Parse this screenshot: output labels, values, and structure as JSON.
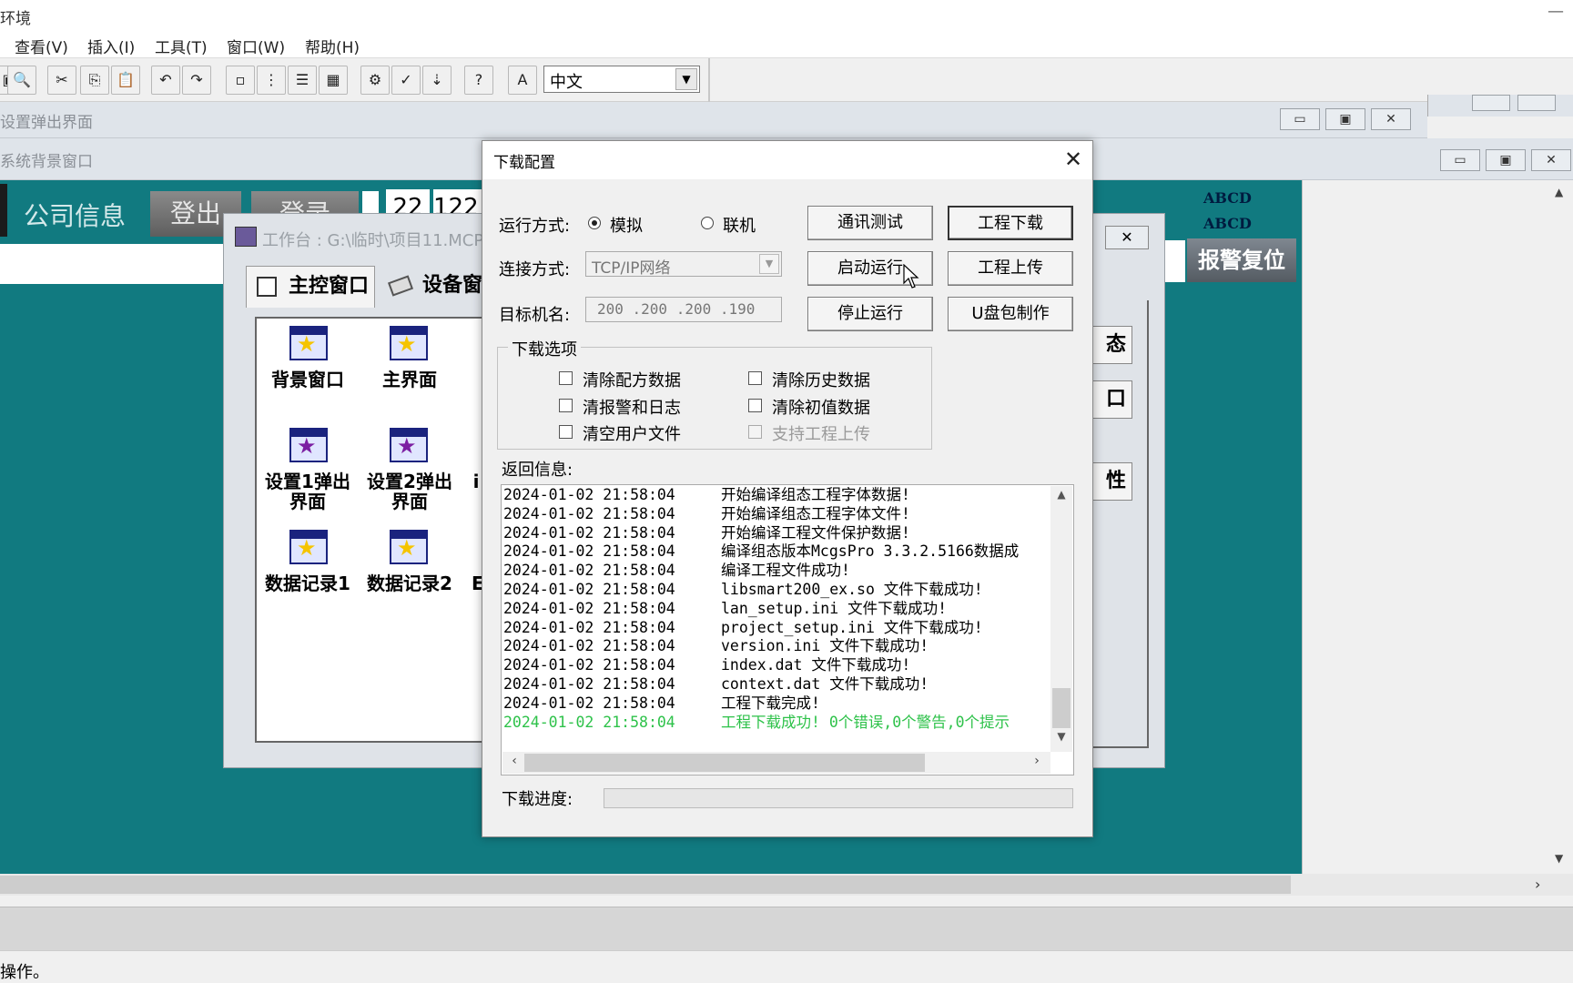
{
  "app": {
    "title": "环境",
    "menu": [
      "查看(V)",
      "插入(I)",
      "工具(T)",
      "窗口(W)",
      "帮助(H)"
    ],
    "language": "中文"
  },
  "mdi": {
    "popup_window_title": "设置弹出界面",
    "background_window_title": "系统背景窗口"
  },
  "canvas": {
    "company_info": "公司信息",
    "logout_label": "登出",
    "login_label": "登录",
    "clock_part1": "22",
    "clock_part2": "122",
    "abcd_line1": "ABCD",
    "abcd_line2": "ABCD",
    "alarm_reset_label": "报警复位"
  },
  "workbench": {
    "title": "工作台 : G:\\临时\\项目11.MCP",
    "tabs": [
      "主控窗口",
      "设备窗"
    ],
    "windows": [
      {
        "label": "背景窗口",
        "star_color": "yellow"
      },
      {
        "label": "主界面",
        "star_color": "yellow"
      },
      {
        "label": "设置1弹出界面",
        "star_color": "purple"
      },
      {
        "label": "设置2弹出界面",
        "star_color": "purple"
      },
      {
        "label": "数据记录1",
        "star_color": "yellow"
      },
      {
        "label": "数据记录2",
        "star_color": "yellow"
      }
    ],
    "partial_labels": [
      "i",
      "E"
    ],
    "side_buttons": [
      "态",
      "口",
      "性"
    ]
  },
  "dialog": {
    "title": "下载配置",
    "run_mode_label": "运行方式:",
    "run_modes": [
      {
        "label": "模拟",
        "selected": true
      },
      {
        "label": "联机",
        "selected": false
      }
    ],
    "connect_label": "连接方式:",
    "connect_value": "TCP/IP网络",
    "target_label": "目标机名:",
    "target_value": "200 .200 .200 .190",
    "buttons": {
      "comm_test": "通讯测试",
      "project_download": "工程下载",
      "start_run": "启动运行",
      "project_upload": "工程上传",
      "stop_run": "停止运行",
      "usb_package": "U盘包制作"
    },
    "options_legend": "下载选项",
    "options": [
      {
        "label": "清除配方数据",
        "checked": false,
        "disabled": false
      },
      {
        "label": "清除历史数据",
        "checked": false,
        "disabled": false
      },
      {
        "label": "清报警和日志",
        "checked": false,
        "disabled": false
      },
      {
        "label": "清除初值数据",
        "checked": false,
        "disabled": false
      },
      {
        "label": "清空用户文件",
        "checked": false,
        "disabled": false
      },
      {
        "label": "支持工程上传",
        "checked": false,
        "disabled": true
      }
    ],
    "return_info_label": "返回信息:",
    "log": [
      {
        "time": "2024-01-02 21:58:04",
        "msg": "开始编译组态工程字体数据!",
        "success": false
      },
      {
        "time": "2024-01-02 21:58:04",
        "msg": "开始编译组态工程字体文件!",
        "success": false
      },
      {
        "time": "2024-01-02 21:58:04",
        "msg": "开始编译工程文件保护数据!",
        "success": false
      },
      {
        "time": "2024-01-02 21:58:04",
        "msg": "编译组态版本McgsPro 3.3.2.5166数据成",
        "success": false
      },
      {
        "time": "2024-01-02 21:58:04",
        "msg": "编译工程文件成功!",
        "success": false
      },
      {
        "time": "2024-01-02 21:58:04",
        "msg": "libsmart200_ex.so 文件下载成功!",
        "success": false
      },
      {
        "time": "2024-01-02 21:58:04",
        "msg": "lan_setup.ini 文件下载成功!",
        "success": false
      },
      {
        "time": "2024-01-02 21:58:04",
        "msg": "project_setup.ini 文件下载成功!",
        "success": false
      },
      {
        "time": "2024-01-02 21:58:04",
        "msg": "version.ini 文件下载成功!",
        "success": false
      },
      {
        "time": "2024-01-02 21:58:04",
        "msg": "index.dat 文件下载成功!",
        "success": false
      },
      {
        "time": "2024-01-02 21:58:04",
        "msg": "context.dat 文件下载成功!",
        "success": false
      },
      {
        "time": "2024-01-02 21:58:04",
        "msg": "工程下载完成!",
        "success": false
      },
      {
        "time": "2024-01-02 21:58:04",
        "msg": "工程下载成功! 0个错误,0个警告,0个提示",
        "success": true
      }
    ],
    "progress_label": "下载进度:",
    "progress_value": 0
  },
  "status": {
    "text": "操作。"
  },
  "icons": {
    "win_icon": "window-star-icon",
    "close": "close-icon",
    "minimize": "minimize-icon",
    "maximize": "maximize-icon"
  },
  "colors": {
    "canvas": "#117a80",
    "log_success": "#2ec24a",
    "window_icon_frame": "#1a237e"
  }
}
